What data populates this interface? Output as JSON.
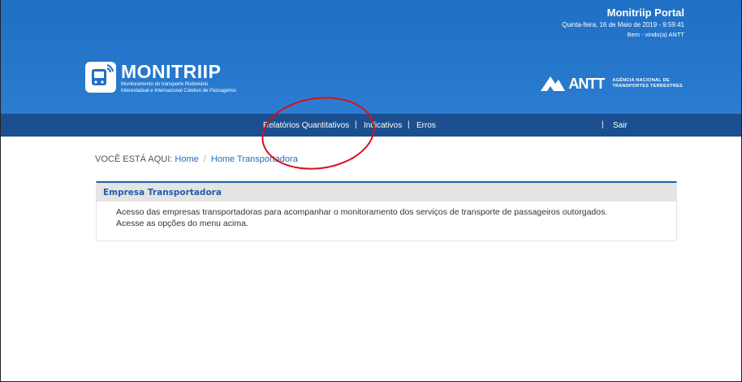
{
  "header": {
    "portal_title": "Monitriip Portal",
    "date": "Quinta-feira, 16 de Maio de 2019 - 9:59:41",
    "welcome": "Bem - vindo(a) ANTT",
    "logo_title": "MONITRIIP",
    "logo_subtitle_1": "Monitoramento do transporte Rodoviário",
    "logo_subtitle_2": "Interestadual e Internacional Coletivo de Passageiros",
    "antt_name": "ANTT",
    "antt_agency_1": "AGÊNCIA NACIONAL DE",
    "antt_agency_2": "TRANSPORTES TERRESTRES"
  },
  "nav": {
    "items": [
      {
        "label": "Relatórios Quantitativos"
      },
      {
        "label": "Indicativos"
      },
      {
        "label": "Erros"
      },
      {
        "label": "Sair"
      }
    ],
    "separator": "|"
  },
  "breadcrumb": {
    "prefix": "VOCÊ ESTÁ AQUI:",
    "items": [
      "Home",
      "Home Transportadora"
    ],
    "separator": "/"
  },
  "panel": {
    "title": "Empresa Transportadora",
    "line1": "Acesso das empresas transportadoras para acompanhar o monitoramento dos serviços de transporte de passageiros outorgados.",
    "line2": "Acesse as opções do menu acima."
  },
  "colors": {
    "header_blue": "#2b7dd1",
    "nav_blue": "#1b4f8f",
    "annotation_red": "#d80f15"
  }
}
